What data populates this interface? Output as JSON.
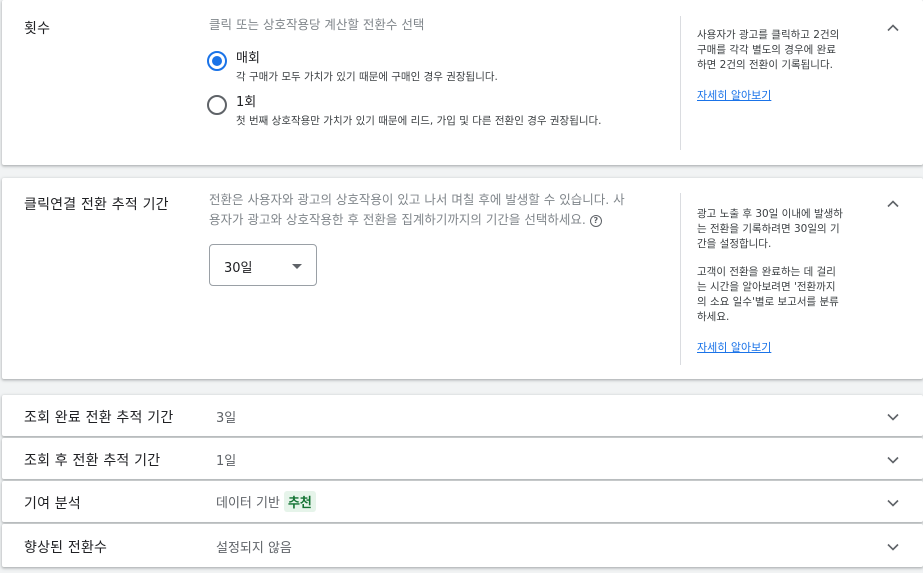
{
  "count_section": {
    "title": "횟수",
    "description": "클릭 또는 상호작용당 계산할 전환수 선택",
    "options": [
      {
        "label": "매회",
        "sub": "각 구매가 모두 가치가 있기 때문에 구매인 경우 권장됩니다.",
        "checked": true
      },
      {
        "label": "1회",
        "sub": "첫 번째 상호작용만 가치가 있기 때문에 리드, 가입 및 다른 전환인 경우 권장됩니다.",
        "checked": false
      }
    ],
    "side_lines": [
      "사용자가 광고를 클릭하고 2건의",
      "구매를 각각 별도의 경우에 완료",
      "하면 2건의 전환이 기록됩니다."
    ],
    "side_link": "자세히 알아보기"
  },
  "click_window_section": {
    "title": "클릭연결 전환 추적 기간",
    "description_lines": [
      "전환은 사용자와 광고의 상호작용이 있고 나서 며칠 후에 발생할 수 있습니다. 사",
      "용자가 광고와 상호작용한 후 전환을 집계하기까지의 기간을 선택하세요."
    ],
    "help_icon": "?",
    "select_value": "30일",
    "side_para1": [
      "광고 노출 후 30일 이내에 발생하",
      "는 전환을 기록하려면 30일의 기",
      "간을 설정합니다."
    ],
    "side_para2": [
      "고객이 전환을 완료하는 데 걸리",
      "는 시간을 알아보려면 '전환까지",
      "의 소요 일수'별로 보고서를 분류",
      "하세요."
    ],
    "side_link": "자세히 알아보기"
  },
  "collapsed_rows": [
    {
      "title": "조회 완료 전환 추적 기간",
      "value": "3일"
    },
    {
      "title": "조회 후 전환 추적 기간",
      "value": "1일"
    },
    {
      "title": "기여 분석",
      "value": "데이터 기반",
      "badge": "추천"
    },
    {
      "title": "향상된 전환수",
      "value": "설정되지 않음"
    }
  ],
  "colors": {
    "accent": "#1a73e8",
    "badge_bg": "#e6f4ea",
    "badge_text": "#137333"
  }
}
